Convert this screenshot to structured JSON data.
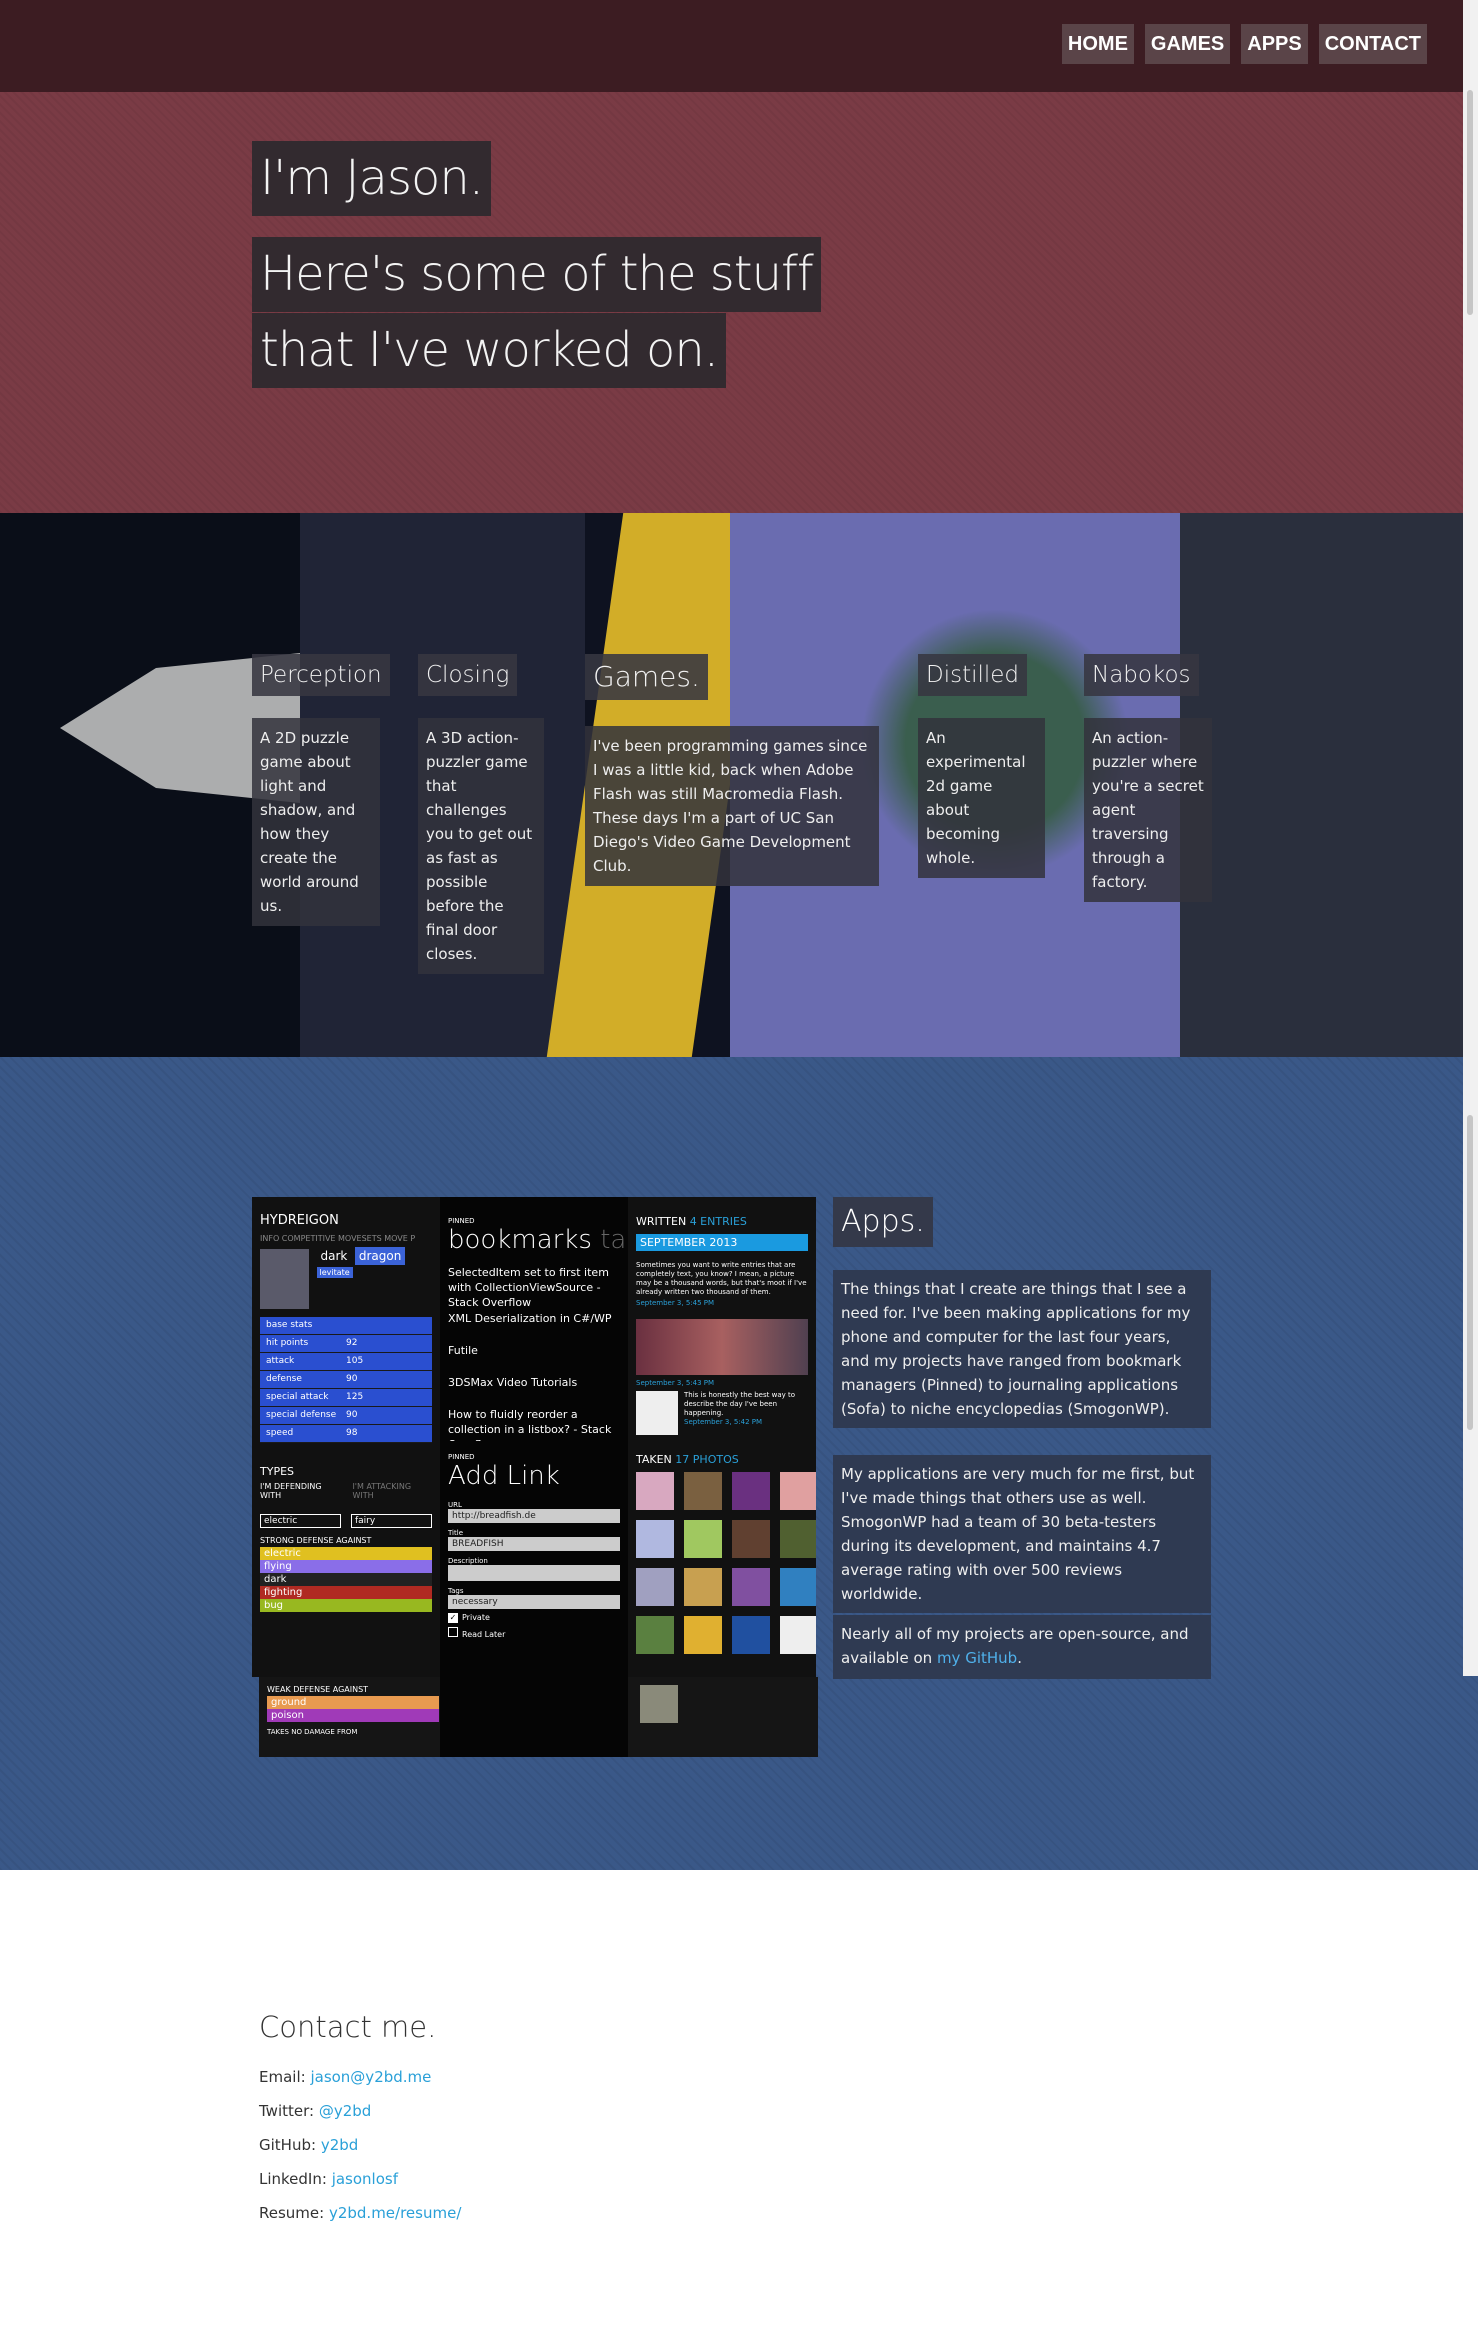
{
  "nav": {
    "items": [
      "HOME",
      "GAMES",
      "APPS",
      "CONTACT"
    ]
  },
  "hero": {
    "line1": "I'm Jason.",
    "line2": "Here's some of the stuff",
    "line3": "that I've worked on."
  },
  "games": {
    "title": "Games.",
    "intro": "I've been programming games since I was a little kid, back when Adobe Flash was still Macromedia Flash. These days I'm a part of UC San Diego's Video Game Development Club.",
    "items": [
      {
        "title": "Perception",
        "desc": "A 2D puzzle game about light and shadow, and how they create the world around us."
      },
      {
        "title": "Closing",
        "desc": "A 3D action-puzzler game that challenges you to get out as fast as possible before the final door closes."
      },
      {
        "title": "Distilled",
        "desc": "An experimental 2d game about becoming whole."
      },
      {
        "title": "Nabokos",
        "desc": "An action-puzzler where you're a secret agent traversing through a factory."
      }
    ]
  },
  "apps": {
    "title": "Apps.",
    "p1": "The things that I create are things that I see a need for. I've been making applications for my phone and computer for the last four years, and my projects have ranged from bookmark managers (Pinned) to journaling applications (Sofa) to niche encyclopedias (SmogonWP).",
    "p2": "My applications are very much for me first, but I've made things that others use as well. SmogonWP had a team of 30 beta-testers during its development, and maintains 4.7 average rating with over 500 reviews worldwide.",
    "p3_pre": "Nearly all of my projects are open-source, and available on ",
    "p3_link": "my GitHub",
    "p3_post": ".",
    "screens": {
      "smogon": {
        "title": "HYDREIGON",
        "tabs": "INFO  COMPETITIVE  MOVESETS  MOVE P",
        "type1": "dark",
        "type2": "dragon",
        "ability": "levitate",
        "stats": [
          [
            "base stats",
            ""
          ],
          [
            "hit points",
            "92"
          ],
          [
            "attack",
            "105"
          ],
          [
            "defense",
            "90"
          ],
          [
            "special attack",
            "125"
          ],
          [
            "special defense",
            "90"
          ],
          [
            "speed",
            "98"
          ]
        ],
        "types_hdr": "TYPES",
        "defending": "I'M DEFENDING WITH",
        "attacking": "I'M ATTACKING WITH",
        "primary": "electric",
        "secondary": "fairy",
        "strong_hdr": "STRONG DEFENSE AGAINST",
        "strong": [
          "electric",
          "flying",
          "dark",
          "fighting",
          "bug"
        ],
        "weak_hdr": "WEAK DEFENSE AGAINST",
        "weak": [
          "ground",
          "poison"
        ],
        "nodmg": "TAKES NO DAMAGE FROM"
      },
      "pinned": {
        "pinned": "PINNED",
        "title": "bookmarks",
        "tag": "tag",
        "links": [
          "SelectedItem set to first item with CollectionViewSource - Stack Overflow",
          "XML Deserialization in C#/WP",
          "Futile",
          "3DSMax Video Tutorials",
          "How to fluidly reorder a collection in a listbox? - Stack Overflow"
        ],
        "add": "Add Link",
        "url_label": "URL",
        "url": "http://breadfish.de",
        "title_label": "Title",
        "title_val": "BREADFISH",
        "desc_label": "Description",
        "tags_label": "Tags",
        "tags_val": "necessary",
        "private": "Private",
        "later": "Read Later"
      },
      "sofa": {
        "written": "WRITTEN",
        "entries": "4 ENTRIES",
        "month": "SEPTEMBER 2013",
        "entry": "Sometimes you want to write entries that are completely text, you know? I mean, a picture may be a thousand words, but that's moot if I've already written two thousand of them.",
        "date1": "September 3, 5:45 PM",
        "date2": "September 3, 5:43 PM",
        "entry2": "This is honestly the best way to describe the day I've been happening.",
        "date3": "September 3, 5:42 PM",
        "taken": "TAKEN",
        "photos": "17 PHOTOS"
      }
    }
  },
  "contact": {
    "title": "Contact me.",
    "rows": [
      {
        "label": "Email: ",
        "value": "jason@y2bd.me"
      },
      {
        "label": "Twitter: ",
        "value": "@y2bd"
      },
      {
        "label": "GitHub: ",
        "value": "y2bd"
      },
      {
        "label": "LinkedIn: ",
        "value": "jasonlosf"
      },
      {
        "label": "Resume: ",
        "value": "y2bd.me/resume/"
      }
    ]
  }
}
